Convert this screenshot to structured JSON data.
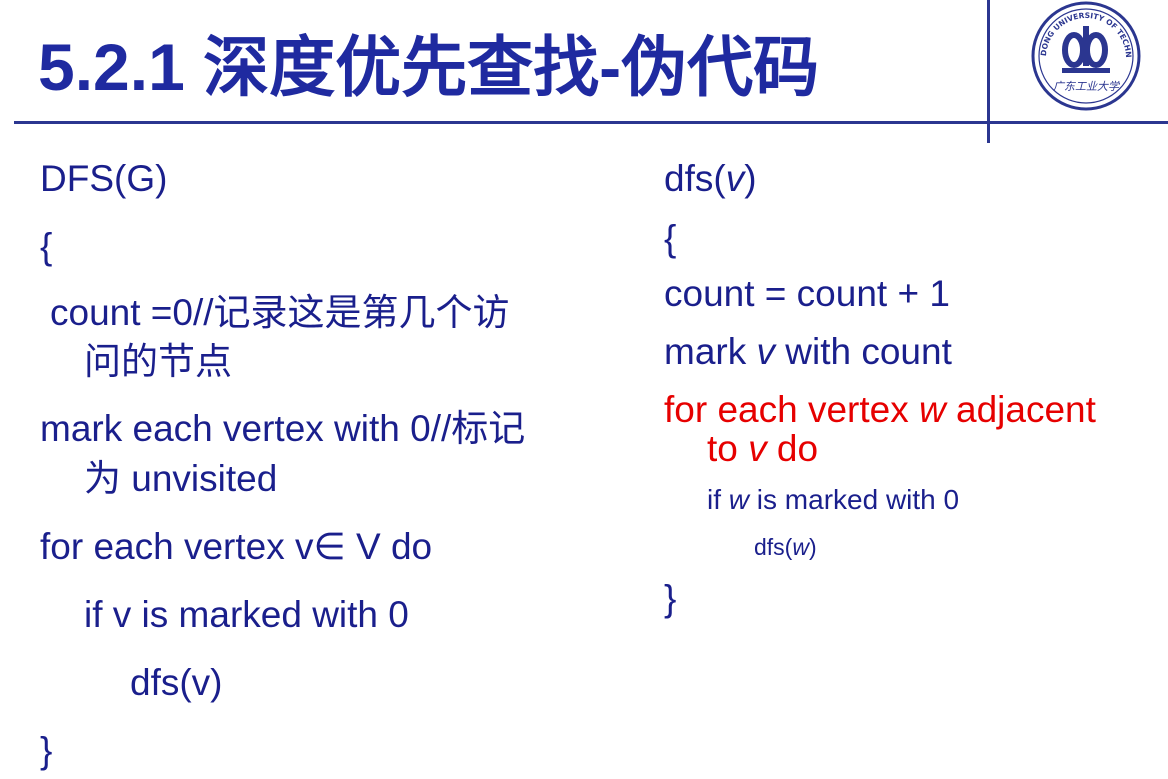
{
  "slide": {
    "title": "5.2.1 深度优先查找-伪代码",
    "logo": {
      "icon": "university-seal-icon",
      "text_arc": "GUANGDONG UNIVERSITY OF TECHNOLOGY",
      "text_cn": "广东工业大学",
      "accent": "#1f2aa0"
    }
  },
  "left": {
    "l1": "DFS(G)",
    "l2": "{",
    "l3": "count =0//记录这是第几个访",
    "l4": "问的节点",
    "l5": "mark each vertex with 0//标记",
    "l6": "为 unvisited",
    "l7": "for each vertex v∈ V do",
    "l8": "if v is marked with 0",
    "l9": "dfs(v)",
    "l10": "}"
  },
  "right": {
    "r1a": "dfs(",
    "r1b": "v",
    "r1c": ")",
    "r2": "{",
    "r3": "count = count + 1",
    "r4a": "mark ",
    "r4b": "v",
    "r4c": " with count",
    "r5a": "for each vertex ",
    "r5b": "w",
    "r5c": " adjacent",
    "r6a": "to ",
    "r6b": "v",
    "r6c": " do",
    "r7a": "if ",
    "r7b": "w",
    "r7c": " is marked with 0",
    "r8a": "dfs(",
    "r8b": "w",
    "r8c": ")",
    "r9": "}"
  },
  "colors": {
    "text": "#1a1f8c",
    "title": "#1f2aa0",
    "highlight": "#e60000",
    "rule": "#2b3690"
  }
}
